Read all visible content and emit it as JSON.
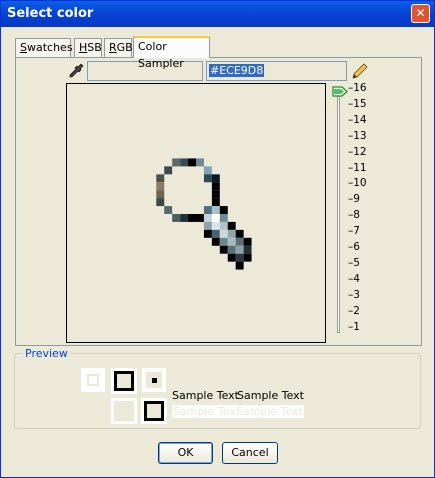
{
  "window": {
    "title": "Select color",
    "close_glyph": "✕"
  },
  "tabs": [
    {
      "label": "Swatches",
      "mnemonic": "S",
      "rest": "watches",
      "active": false
    },
    {
      "label": "HSB",
      "mnemonic": "H",
      "rest": "SB",
      "active": false
    },
    {
      "label": "RGB",
      "mnemonic": "R",
      "rest": "GB",
      "active": false
    },
    {
      "label": "Color Sampler",
      "active": true
    }
  ],
  "sampler": {
    "hex_value": "#ECE9D8",
    "eyedropper_icon": "eyedropper-icon",
    "pencil_icon": "pencil-icon",
    "zoom_ticks": [
      "16",
      "15",
      "14",
      "13",
      "12",
      "11",
      "10",
      "9",
      "8",
      "7",
      "6",
      "5",
      "4",
      "3",
      "2",
      "1"
    ],
    "zoom_value": 16
  },
  "preview": {
    "legend": "Preview",
    "sample_text_1": "Sample Text",
    "sample_text_2": "Sample Text",
    "sample_text_3": "Sample Text",
    "sample_text_4": "Sample Text"
  },
  "buttons": {
    "ok": "OK",
    "cancel": "Cancel"
  },
  "colors": {
    "title_bar": "#0845d6",
    "dialog_bg": "#ece9d8",
    "selection": "#316ac5",
    "legend": "#0046d5"
  }
}
